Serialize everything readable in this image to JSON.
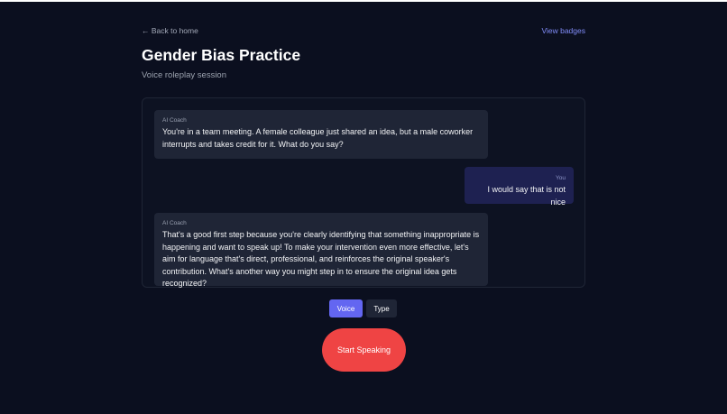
{
  "header": {
    "back_label": "← Back to home",
    "badges_label": "View badges",
    "title": "Gender Bias Practice",
    "subtitle": "Voice roleplay session"
  },
  "chat": {
    "messages": [
      {
        "sender": "AI Coach",
        "text": "You're in a team meeting. A female colleague just shared an idea, but a male coworker interrupts and takes credit for it. What do you say?"
      },
      {
        "sender": "You",
        "text": "I would say that is not nice"
      },
      {
        "sender": "AI Coach",
        "text": "That's a good first step because you're clearly identifying that something inappropriate is happening and want to speak up! To make your intervention even more effective, let's aim for language that's direct, professional, and reinforces the original speaker's contribution. What's another way you might step in to ensure the original idea gets recognized?"
      }
    ]
  },
  "controls": {
    "mode_options": [
      "Voice",
      "Type"
    ],
    "selected_mode": "Voice",
    "speak_label": "Start Speaking"
  },
  "colors": {
    "background": "#0b0f1f",
    "accent": "#6366f1",
    "link": "#818cf8",
    "speak_button": "#ef4444",
    "coach_bubble": "#1f2536",
    "user_bubble": "#1e2151"
  }
}
